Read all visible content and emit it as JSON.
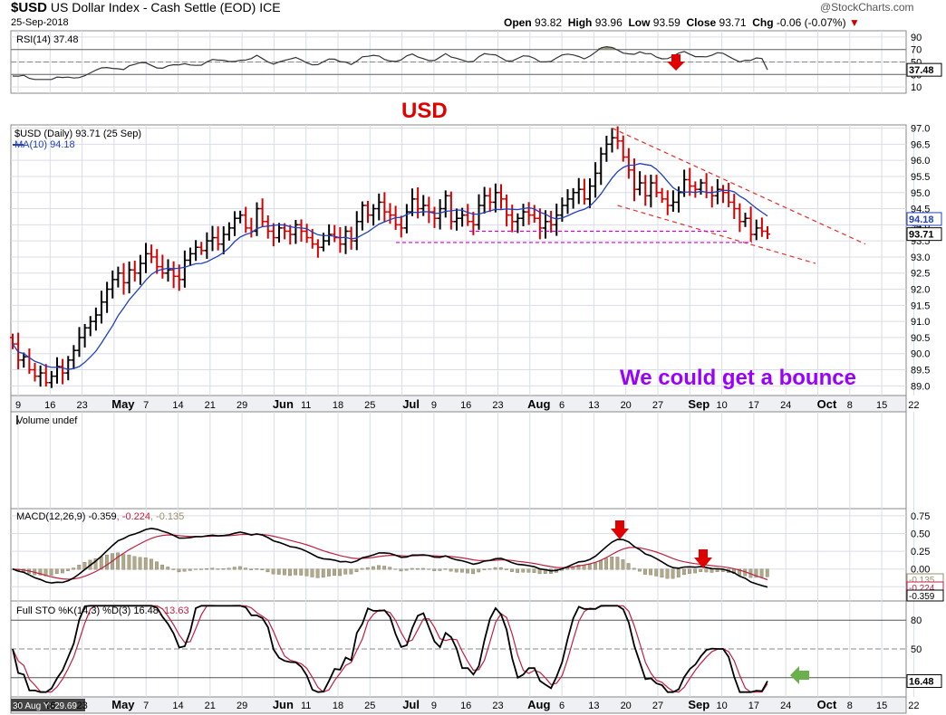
{
  "header": {
    "ticker": "$USD",
    "name": "US Dollar Index - Cash Settle (EOD)",
    "exchange": "ICE",
    "date": "25-Sep-2018",
    "open_label": "Open",
    "open": "93.82",
    "high_label": "High",
    "high": "93.96",
    "low_label": "Low",
    "low": "93.59",
    "close_label": "Close",
    "close": "93.71",
    "chg_label": "Chg",
    "chg": "-0.06 (-0.07%)",
    "brand": "@StockCharts.com"
  },
  "colors": {
    "up_bar": "#000000",
    "down_bar": "#d40000",
    "ma": "#2040c0",
    "annotation_red": "#e00000",
    "annotation_purple": "#9900ff",
    "hist": "#b0a888",
    "grid": "#d9dde6",
    "signal_red": "#c02040",
    "arrow_green": "#6ab04c"
  },
  "chart_data": [
    {
      "name": "price",
      "type": "ohlc",
      "legend": "$USD (Daily) 93.71 (25 Sep)",
      "ma_legend": "MA(10) 94.18",
      "annotation": "USD",
      "note": "We could get a bounce",
      "ylim": [
        88.7,
        97.1
      ],
      "yticks": [
        "97.0",
        "96.5",
        "96.0",
        "95.5",
        "95.0",
        "94.5",
        "94.0",
        "93.5",
        "93.0",
        "92.5",
        "92.0",
        "91.5",
        "91.0",
        "90.5",
        "90.0",
        "89.5",
        "89.0"
      ],
      "last_label": "93.71",
      "ma_label": "94.18",
      "closes": [
        90.3,
        89.8,
        89.9,
        89.5,
        89.3,
        89.4,
        89.1,
        89.3,
        89.6,
        89.4,
        89.8,
        90.1,
        90.5,
        90.8,
        91.0,
        91.2,
        91.6,
        92.0,
        92.3,
        92.5,
        92.2,
        92.6,
        92.5,
        92.8,
        93.1,
        93.0,
        92.7,
        92.5,
        92.6,
        92.4,
        92.3,
        92.9,
        93.1,
        93.3,
        93.2,
        93.5,
        93.6,
        93.4,
        93.7,
        93.9,
        94.2,
        94.3,
        93.9,
        93.8,
        94.5,
        94.1,
        93.8,
        93.6,
        93.9,
        93.8,
        93.7,
        94.0,
        93.8,
        93.6,
        93.4,
        93.3,
        93.5,
        93.7,
        93.6,
        93.4,
        93.8,
        93.5,
        94.1,
        94.6,
        94.3,
        94.5,
        94.7,
        94.4,
        94.3,
        94.0,
        93.9,
        94.4,
        94.8,
        94.5,
        94.6,
        94.4,
        94.2,
        94.5,
        94.9,
        94.1,
        94.2,
        94.3,
        94.1,
        94.0,
        94.6,
        94.9,
        94.7,
        95.0,
        94.8,
        94.3,
        94.1,
        94.2,
        94.4,
        94.3,
        94.2,
        93.9,
        94.1,
        94.0,
        94.3,
        94.6,
        94.8,
        95.0,
        95.1,
        94.8,
        95.2,
        95.6,
        96.2,
        96.5,
        96.7,
        96.6,
        96.1,
        95.7,
        95.1,
        95.3,
        94.9,
        95.3,
        95.0,
        94.8,
        94.6,
        94.7,
        95.0,
        95.4,
        95.2,
        95.1,
        95.3,
        95.0,
        94.9,
        95.1,
        95.0,
        94.7,
        94.5,
        94.1,
        94.2,
        93.7,
        93.9,
        93.8,
        93.71
      ]
    },
    {
      "name": "rsi",
      "type": "line",
      "legend": "RSI(14) 37.48",
      "ylim": [
        0,
        100
      ],
      "yticks": [
        "90",
        "70",
        "50",
        "30",
        "10"
      ],
      "last_label": "37.48",
      "levels": [
        70,
        30
      ]
    },
    {
      "name": "volume",
      "type": "bar",
      "legend": "Volume undef"
    },
    {
      "name": "macd",
      "type": "line",
      "legend_main": "MACD(12,26,9) -0.359",
      "legend_sig": ", -0.224",
      "legend_hist": ", -0.135",
      "ylim": [
        -0.45,
        0.85
      ],
      "yticks": [
        "0.75",
        "0.50",
        "0.25",
        "0.00",
        "-0.25"
      ],
      "labels": [
        "-0.135",
        "-0.224",
        "-0.359"
      ]
    },
    {
      "name": "stochastic",
      "type": "line",
      "legend_main": "Full STO %K(14,3) %D(3) 16.48",
      "legend_sig": ", 13.63",
      "ylim": [
        0,
        100
      ],
      "yticks": [
        "80",
        "50",
        "20"
      ],
      "last_label": "16.48",
      "levels": [
        80,
        50,
        20
      ]
    }
  ],
  "xaxis": {
    "labels": [
      "9",
      "16",
      "23",
      "May",
      "7",
      "14",
      "21",
      "29",
      "Jun",
      "11",
      "18",
      "25",
      "Jul",
      "9",
      "16",
      "23",
      "Aug",
      "6",
      "13",
      "20",
      "27",
      "Sep",
      "10",
      "17",
      "24",
      "Oct",
      "8",
      "15",
      "22"
    ],
    "bold": [
      "May",
      "Jun",
      "Jul",
      "Aug",
      "Sep",
      "Oct"
    ],
    "footer": "30 Aug Y:-29.69"
  }
}
